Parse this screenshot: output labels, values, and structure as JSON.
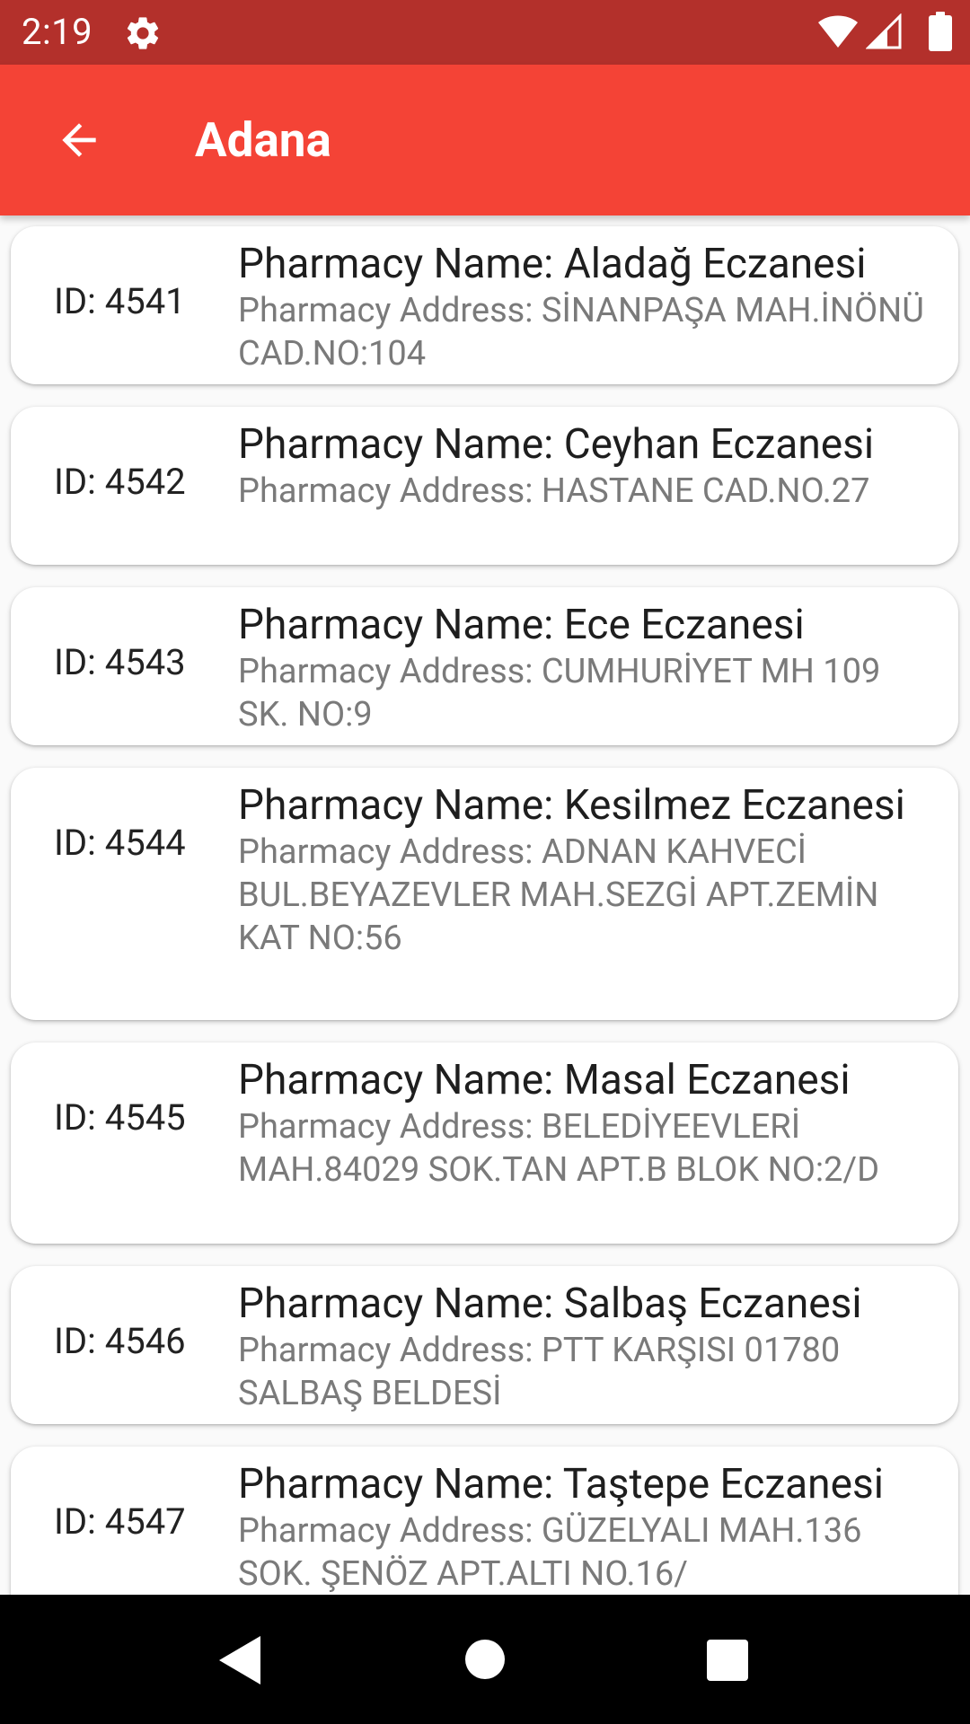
{
  "status_bar": {
    "time": "2:19",
    "icons": [
      "gear-icon",
      "wifi-icon",
      "cell-signal-icon",
      "battery-icon"
    ]
  },
  "app_bar": {
    "title": "Adana",
    "back_icon": "arrow-left-icon"
  },
  "pharmacies": [
    {
      "id_label": "ID: 4541",
      "name": "Pharmacy Name: Aladağ Eczanesi",
      "address": "Pharmacy Address: SİNANPAŞA MAH.İNÖNÜ CAD.NO:104"
    },
    {
      "id_label": "ID: 4542",
      "name": "Pharmacy Name: Ceyhan Eczanesi",
      "address": "Pharmacy Address: HASTANE CAD.NO.27"
    },
    {
      "id_label": "ID: 4543",
      "name": "Pharmacy Name: Ece Eczanesi",
      "address": "Pharmacy Address: CUMHURİYET MH 109 SK. NO:9"
    },
    {
      "id_label": "ID: 4544",
      "name": "Pharmacy Name: Kesilmez Eczanesi",
      "address": "Pharmacy Address: ADNAN KAHVECİ BUL.BEYAZEVLER MAH.SEZGİ APT.ZEMİN KAT NO:56"
    },
    {
      "id_label": "ID: 4545",
      "name": "Pharmacy Name: Masal Eczanesi",
      "address": "Pharmacy Address: BELEDİYEEVLERİ MAH.84029 SOK.TAN APT.B BLOK NO:2/D"
    },
    {
      "id_label": "ID: 4546",
      "name": "Pharmacy Name: Salbaş Eczanesi",
      "address": "Pharmacy Address: PTT KARŞISI 01780 SALBAŞ BELDESİ"
    },
    {
      "id_label": "ID: 4547",
      "name": "Pharmacy Name: Taştepe Eczanesi",
      "address": "Pharmacy Address: GÜZELYALI MAH.136 SOK. ŞENÖZ APT.ALTI NO.16/"
    }
  ],
  "nav_bar": {
    "icons": [
      "nav-back-icon",
      "nav-home-icon",
      "nav-recents-icon"
    ]
  },
  "colors": {
    "status_bar": "#b3302b",
    "app_bar": "#f44336",
    "background": "#fafafa",
    "card": "#ffffff",
    "name_text": "#1e1e1e",
    "address_text": "#7a7a7a"
  }
}
